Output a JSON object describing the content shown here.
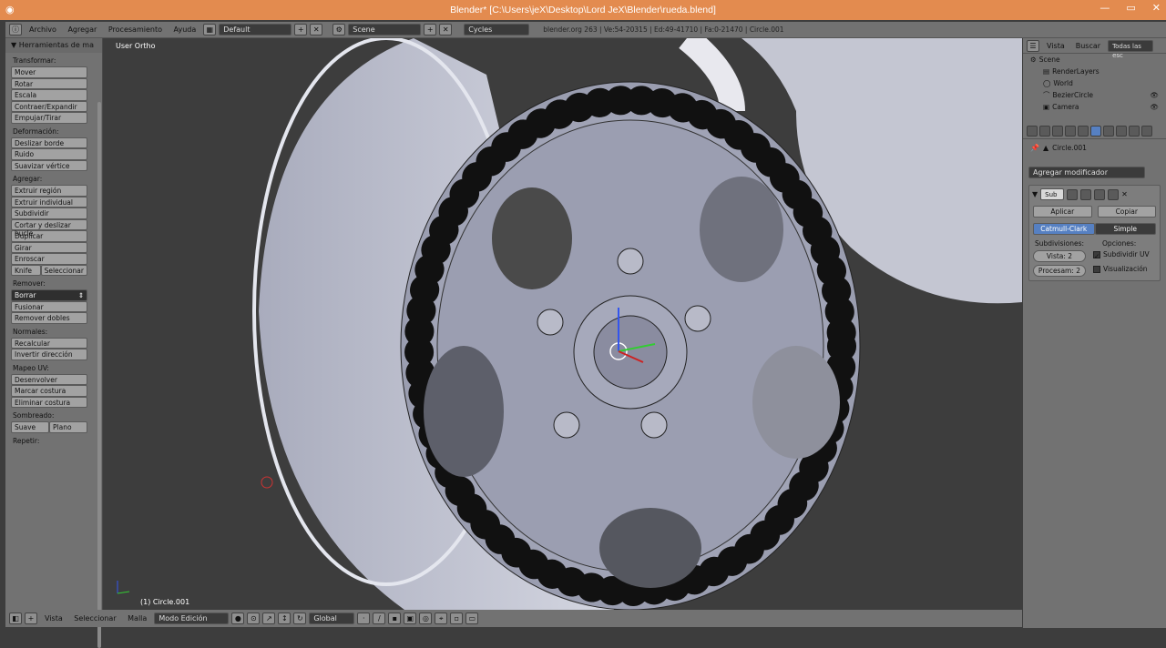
{
  "window": {
    "title": "Blender* [C:\\Users\\jeX\\Desktop\\Lord JeX\\Blender\\rueda.blend]"
  },
  "header": {
    "menus": [
      "Archivo",
      "Agregar",
      "Procesamiento",
      "Ayuda"
    ],
    "layout": "Default",
    "scene": "Scene",
    "engine": "Cycles",
    "info": "blender.org 263 | Ve:54-20315 | Ed:49-41710 | Fa:0-21470 | Circle.001"
  },
  "sidebar": {
    "title": "Herramientas de ma",
    "sections": [
      {
        "label": "Transformar:",
        "buttons": [
          "Mover",
          "Rotar",
          "Escala",
          "Contraer/Expandir",
          "Empujar/Tirar"
        ]
      },
      {
        "label": "Deformación:",
        "buttons": [
          "Deslizar borde",
          "Ruido",
          "Suavizar vértice"
        ]
      },
      {
        "label": "Agregar:",
        "buttons": [
          "Extruir región",
          "Extruir individual",
          "Subdividir",
          "Cortar y deslizar bucle",
          "Duplicar",
          "Girar",
          "Enroscar"
        ]
      },
      {
        "label": "Remover:",
        "buttons": [
          "Fusionar",
          "Remover dobles"
        ]
      },
      {
        "label": "Normales:",
        "buttons": [
          "Recalcular",
          "Invertir dirección"
        ]
      },
      {
        "label": "Mapeo UV:",
        "buttons": [
          "Desenvolver",
          "Marcar costura",
          "Eliminar costura"
        ]
      },
      {
        "label": "Sombreado:",
        "buttons": []
      },
      {
        "label": "Repetir:",
        "buttons": []
      }
    ],
    "knife": "Knife",
    "select": "Seleccionar",
    "delete": "Borrar",
    "smooth": "Suave",
    "flat": "Plano"
  },
  "viewport": {
    "view_label": "User Ortho",
    "object_label": "(1) Circle.001"
  },
  "footer": {
    "menus": [
      "Vista",
      "Seleccionar",
      "Malla"
    ],
    "mode": "Modo Edición",
    "orientation": "Global"
  },
  "outliner": {
    "menus": [
      "Vista",
      "Buscar"
    ],
    "filter": "Todas las esc",
    "items": [
      "Scene",
      "RenderLayers",
      "World",
      "BezierCircle",
      "Camera"
    ]
  },
  "properties": {
    "object": "Circle.001",
    "add_modifier": "Agregar modificador",
    "modifier_name": "Sub",
    "apply": "Aplicar",
    "copy": "Copiar",
    "type_catmull": "Catmull-Clark",
    "type_simple": "Simple",
    "subdivisions_label": "Subdivisiones:",
    "options_label": "Opciones:",
    "view_field": "Vista: 2",
    "render_field": "Procesam: 2",
    "subdivide_uv": "Subdividir UV",
    "optimal_display": "Visualización"
  },
  "colors": {
    "titlebar": "#e38b4f",
    "panel": "#727272",
    "viewport": "#3d3d3d",
    "active_tab": "#5680c2"
  }
}
